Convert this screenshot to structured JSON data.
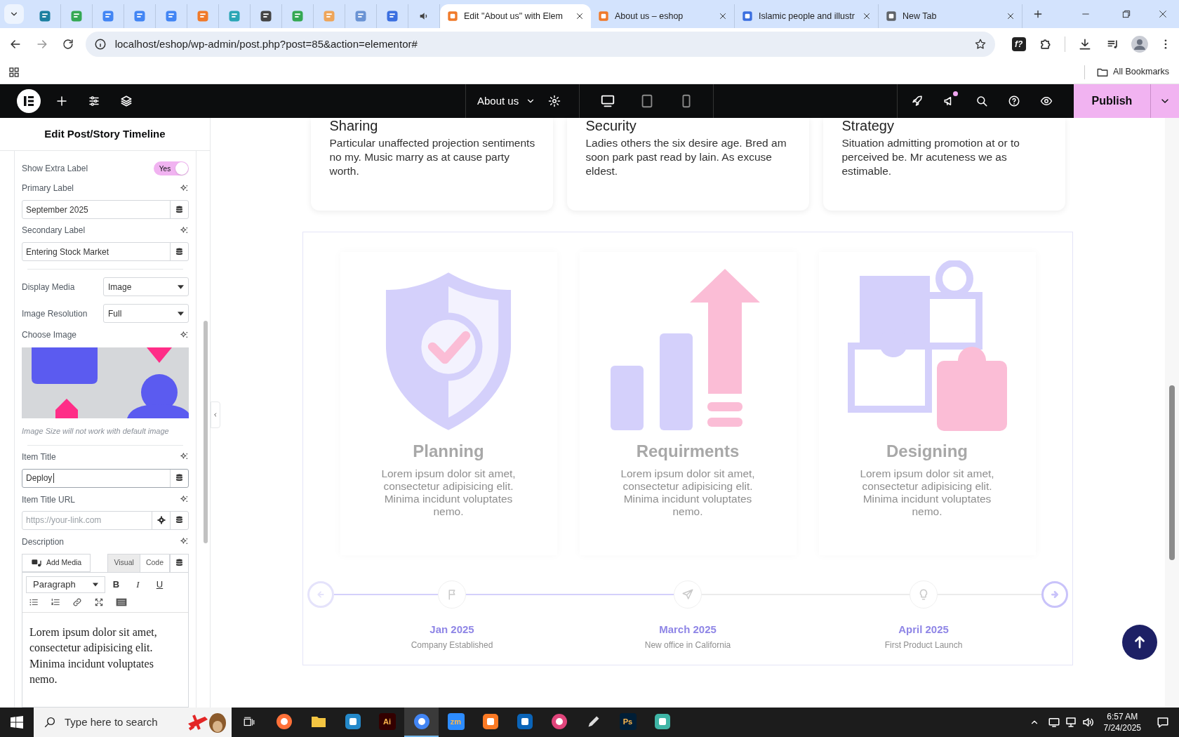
{
  "browser": {
    "tabs": [
      {
        "kind": "icon",
        "color": "#1b7fa0",
        "selected": false
      },
      {
        "kind": "icon",
        "color": "#34a853",
        "selected": false
      },
      {
        "kind": "icon",
        "color": "#4285f4",
        "selected": false
      },
      {
        "kind": "icon",
        "color": "#4285f4",
        "selected": false
      },
      {
        "kind": "icon",
        "color": "#4285f4",
        "selected": false
      },
      {
        "kind": "icon",
        "color": "#f07a2a",
        "selected": false
      },
      {
        "kind": "icon",
        "color": "#2aa6b5",
        "selected": false
      },
      {
        "kind": "icon",
        "color": "#444444",
        "selected": false
      },
      {
        "kind": "icon",
        "color": "#34a853",
        "selected": false
      },
      {
        "kind": "icon",
        "color": "#eea55a",
        "selected": false
      },
      {
        "kind": "icon",
        "color": "#6a93d4",
        "selected": false
      },
      {
        "kind": "icon",
        "color": "#3b6fe0",
        "selected": false
      },
      {
        "kind": "audio",
        "color": "#444444",
        "selected": false
      },
      {
        "kind": "page",
        "title": "Edit \"About us\" with Elem",
        "color": "#f07a2a",
        "selected": true
      },
      {
        "kind": "page",
        "title": "About us – eshop",
        "color": "#f07a2a",
        "selected": false
      },
      {
        "kind": "page",
        "title": "Islamic people and illustr",
        "color": "#3b6fe0",
        "selected": false
      },
      {
        "kind": "page",
        "title": "New Tab",
        "color": "#5f6368",
        "selected": false
      }
    ],
    "address": "localhost/eshop/wp-admin/post.php?post=85&action=elementor#",
    "extension_label": "f?",
    "bookmarks_folder": "All Bookmarks"
  },
  "editor": {
    "page_title": "About us",
    "devices": [
      {
        "kind": "desktop",
        "selected": true
      },
      {
        "kind": "tablet",
        "selected": false
      },
      {
        "kind": "mobile",
        "selected": false
      }
    ],
    "notification": true,
    "publish": "Publish"
  },
  "panel": {
    "title": "Edit Post/Story Timeline",
    "controls": [
      {
        "kind": "switch",
        "label": "Show Extra Label",
        "on": true,
        "on_text": "Yes"
      },
      {
        "kind": "text",
        "label": "Primary Label",
        "value": "September 2025",
        "focused": false
      },
      {
        "kind": "text",
        "label": "Secondary Label",
        "value": "Entering Stock Market",
        "focused": false
      },
      {
        "kind": "divider"
      },
      {
        "kind": "select",
        "label": "Display Media",
        "value": "Image"
      },
      {
        "kind": "select",
        "label": "Image Resolution",
        "value": "Full"
      },
      {
        "label": "Choose Image",
        "note": "Image Size will not work with default image"
      },
      {
        "kind": "divider"
      },
      {
        "kind": "text",
        "label": "Item Title",
        "value": "Deploy",
        "focused": true
      },
      {
        "kind": "url",
        "label": "Item Title URL",
        "placeholder": "https://your-link.com"
      },
      {
        "kind": "editor",
        "label": "Description",
        "add_media": "Add Media",
        "modes": [
          {
            "label": "Visual",
            "selected": true
          },
          {
            "label": "Code",
            "selected": false
          }
        ],
        "format": "Paragraph",
        "format_buttons": [
          {
            "kind": "bold",
            "label": "B"
          },
          {
            "kind": "italic",
            "label": "I"
          },
          {
            "kind": "underline",
            "label": "U"
          }
        ],
        "text": "Lorem ipsum dolor sit amet, consectetur adipisicing elit. Minima incidunt voluptates nemo."
      }
    ]
  },
  "canvas": {
    "features": [
      {
        "title": "Sharing",
        "text": "Particular unaffected projection sentiments no my. Music marry as at cause party worth."
      },
      {
        "title": "Security",
        "text": "Ladies others the six desire age. Bred am soon park past read by lain. As excuse eldest."
      },
      {
        "title": "Strategy",
        "text": "Situation admitting promotion at or to perceived be. Mr acuteness we as estimable."
      }
    ],
    "timeline": {
      "prev_enabled": false,
      "next_enabled": true,
      "items": [
        {
          "illustration": {
            "kind": "shield"
          },
          "title": "Planning",
          "description": "Lorem ipsum dolor sit amet, consectetur adipisicing elit. Minima incidunt voluptates nemo.",
          "marker": {
            "kind": "flag"
          },
          "reached": true,
          "date": "Jan 2025",
          "caption": "Company Established"
        },
        {
          "illustration": {
            "kind": "chart"
          },
          "title": "Requirments",
          "description": "Lorem ipsum dolor sit amet, consectetur adipisicing elit. Minima incidunt voluptates nemo.",
          "marker": {
            "kind": "plane"
          },
          "reached": true,
          "date": "March 2025",
          "caption": "New office in California"
        },
        {
          "illustration": {
            "kind": "puzzle"
          },
          "title": "Designing",
          "description": "Lorem ipsum dolor sit amet, consectetur adipisicing elit. Minima incidunt voluptates nemo.",
          "marker": {
            "kind": "bulb"
          },
          "reached": false,
          "date": "April 2025",
          "caption": "First Product Launch"
        }
      ]
    }
  },
  "taskbar": {
    "search_placeholder": "Type here to search",
    "apps": [
      {
        "kind": "round",
        "color": "#ff7139",
        "selected": false
      },
      {
        "kind": "folder",
        "color": "#f4c542",
        "selected": false
      },
      {
        "kind": "square",
        "color": "#2489ca",
        "selected": false
      },
      {
        "kind": "label",
        "label": "Ai",
        "color": "#330000",
        "selected": false
      },
      {
        "kind": "round",
        "color": "#4285f4",
        "selected": true
      },
      {
        "kind": "label",
        "label": "zm",
        "color": "#2d8cff",
        "selected": false
      },
      {
        "kind": "square",
        "color": "#fb7a24",
        "selected": false
      },
      {
        "kind": "square",
        "color": "#0a64b8",
        "selected": false
      },
      {
        "kind": "round",
        "color": "#e0457b",
        "selected": false
      },
      {
        "kind": "pen",
        "color": "#dddddd",
        "selected": false
      },
      {
        "kind": "label",
        "label": "Ps",
        "color": "#001e36",
        "selected": false
      },
      {
        "kind": "square",
        "color": "#3fb5a6",
        "selected": false
      }
    ],
    "time": "6:57 AM",
    "date": "7/24/2025"
  }
}
